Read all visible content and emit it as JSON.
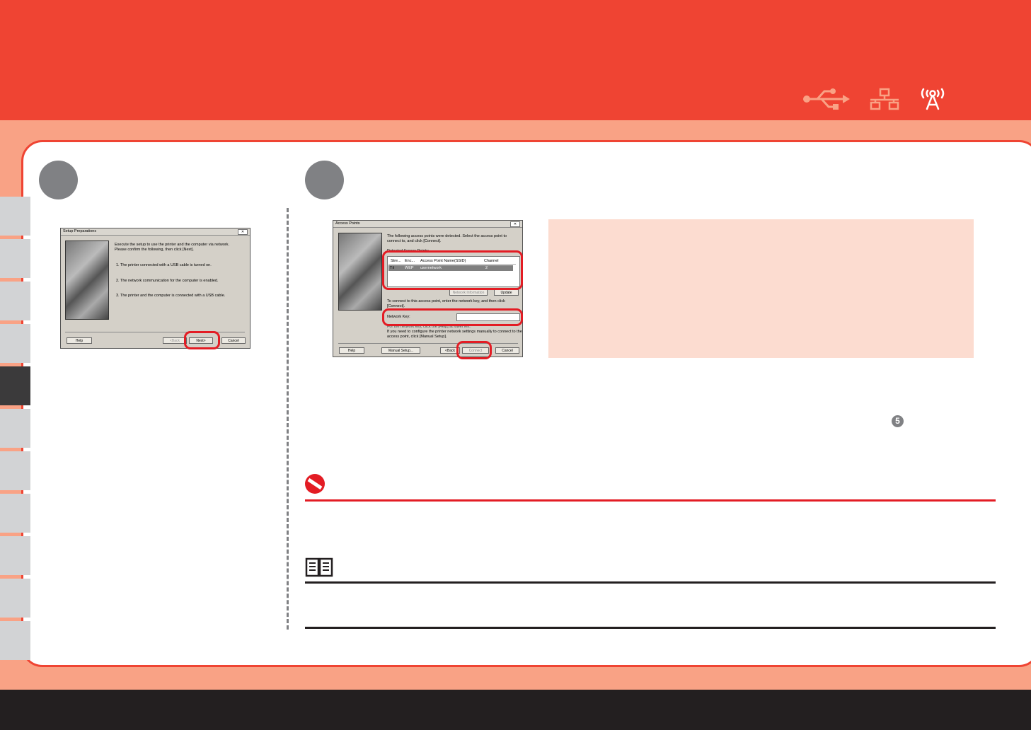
{
  "header": {
    "icons": [
      "usb-icon",
      "wired-lan-icon",
      "wireless-icon"
    ],
    "brand_color": "#ef4433"
  },
  "setup_dialog": {
    "title": "Setup Preparations",
    "close": "✕",
    "intro_line1": "Execute the setup to use the printer and the computer via network.",
    "intro_line2": "Please confirm the following, then click [Next].",
    "item1": "1.   The printer connected with a USB cable is turned on.",
    "item2": "2.   The network communication for the computer is enabled.",
    "item3": "3.   The printer and the computer is connected with a USB cable.",
    "help": "Help",
    "back": "<Back",
    "next": "Next>",
    "cancel": "Cancel"
  },
  "ap_dialog": {
    "title": "Access Points",
    "close": "✕",
    "intro_line1": "The following access points were detected. Select the access point to",
    "intro_line2": "connect to, and click [Connect].",
    "group_label": "Detected Access Points:",
    "columns": [
      "Stre...",
      "Enc...",
      "Access Point Name(SSID)",
      "Channel"
    ],
    "row": {
      "signal": "Tıl",
      "enc": "WEP",
      "ssid": "usernetwork",
      "channel": "2"
    },
    "network_info": "Network Information",
    "update": "Update",
    "key_instr_line1": "To connect to this access point, enter the network key, and then click",
    "key_instr_line2": "[Connect].",
    "network_key_label": "Network Key:",
    "network_key_value": "",
    "help_line": "For the network key, click the [Help] at lower left.",
    "manual_line1": "If you need to configure the printer network settings manually to connect to the",
    "manual_line2": "access point, click [Manual Setup].",
    "help": "Help",
    "manual_setup": "Manual Setup...",
    "back": "<Back",
    "connect": "Connect",
    "cancel": "Cancel"
  },
  "step_ref": "5"
}
